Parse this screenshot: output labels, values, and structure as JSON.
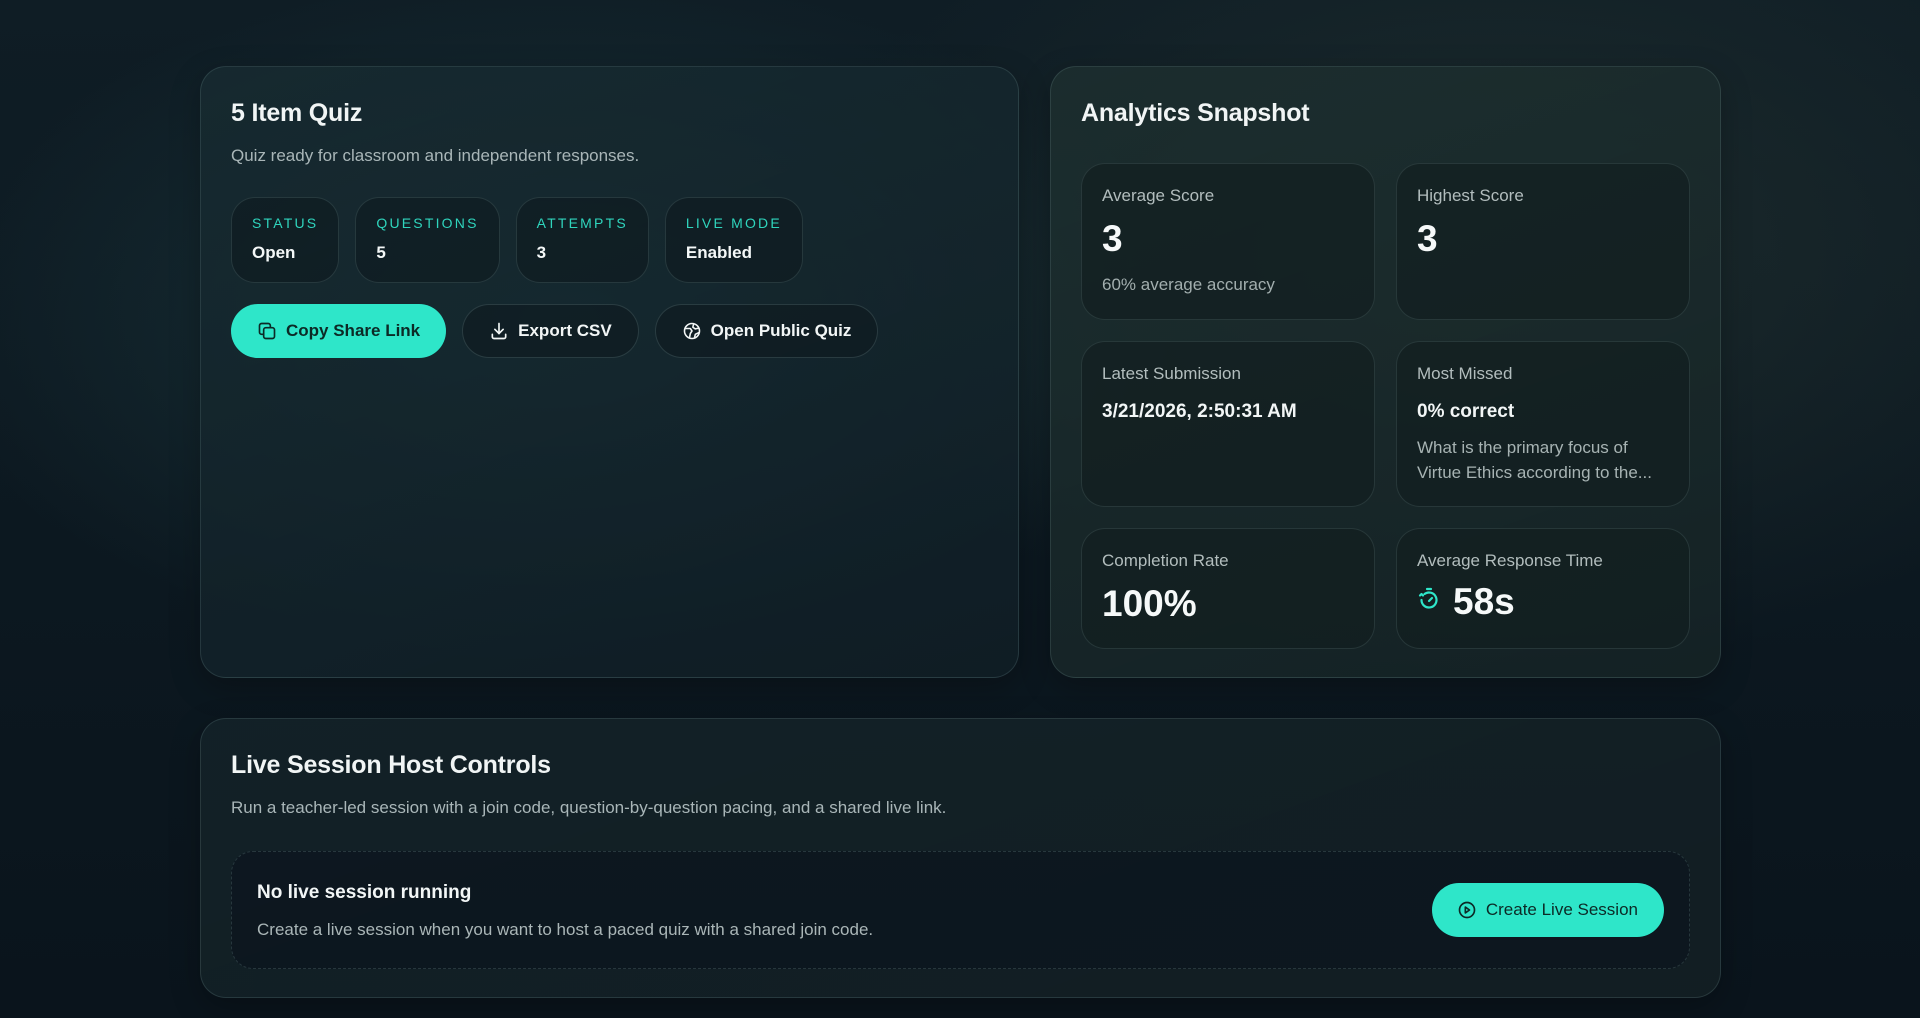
{
  "quiz": {
    "title": "5 Item Quiz",
    "subtitle": "Quiz ready for classroom and independent responses.",
    "stats": [
      {
        "label": "STATUS",
        "value": "Open"
      },
      {
        "label": "QUESTIONS",
        "value": "5"
      },
      {
        "label": "ATTEMPTS",
        "value": "3"
      },
      {
        "label": "LIVE MODE",
        "value": "Enabled"
      }
    ],
    "actions": {
      "copy_label": "Copy Share Link",
      "export_label": "Export CSV",
      "open_label": "Open Public Quiz"
    }
  },
  "analytics": {
    "title": "Analytics Snapshot",
    "average_score": {
      "label": "Average Score",
      "value": "3",
      "note": "60% average accuracy"
    },
    "highest_score": {
      "label": "Highest Score",
      "value": "3"
    },
    "latest_submission": {
      "label": "Latest Submission",
      "value": "3/21/2026, 2:50:31 AM"
    },
    "most_missed": {
      "label": "Most Missed",
      "value": "0% correct",
      "question": "What is the primary focus of Virtue Ethics according to the..."
    },
    "completion_rate": {
      "label": "Completion Rate",
      "value": "100%"
    },
    "avg_response_time": {
      "label": "Average Response Time",
      "value": "58s"
    }
  },
  "live_session": {
    "title": "Live Session Host Controls",
    "subtitle": "Run a teacher-led session with a join code, question-by-question pacing, and a shared live link.",
    "empty_title": "No live session running",
    "empty_desc": "Create a live session when you want to host a paced quiz with a shared join code.",
    "create_label": "Create Live Session"
  },
  "icons": {
    "copy": "copy-icon",
    "export": "download-icon",
    "open": "globe-icon",
    "timer": "timer-icon",
    "play": "play-circle-icon"
  },
  "colors": {
    "accent": "#2ee6c9",
    "stat_label": "#2fd5bd"
  }
}
